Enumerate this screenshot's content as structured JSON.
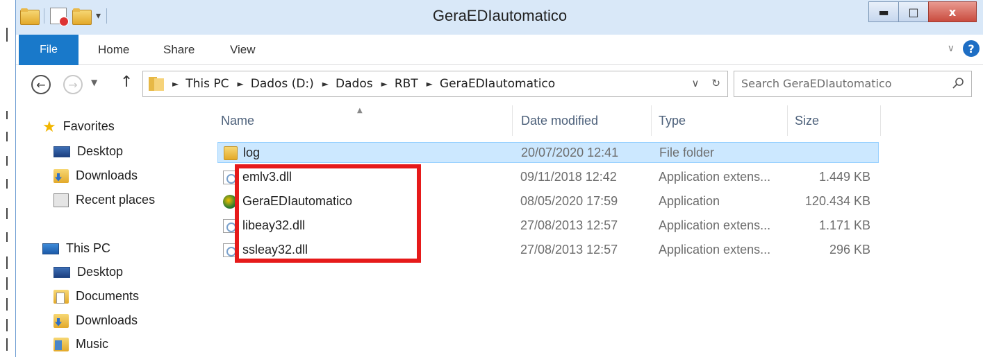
{
  "window": {
    "title": "GeraEDIautomatico",
    "minimize": "▬",
    "maximize": "□",
    "close": "x"
  },
  "ribbon": {
    "tabs": [
      "File",
      "Home",
      "Share",
      "View"
    ],
    "help": "?",
    "expand": "∨"
  },
  "nav": {
    "back": "←",
    "forward": "→",
    "recent": "▼",
    "up": "↑",
    "path": [
      "This PC",
      "Dados (D:)",
      "Dados",
      "RBT",
      "GeraEDIautomatico"
    ],
    "path_separator": "►",
    "dropdown": "∨",
    "refresh": "↻"
  },
  "search": {
    "placeholder": "Search GeraEDIautomatico"
  },
  "sidebar": {
    "favorites_label": "Favorites",
    "favorites": [
      "Desktop",
      "Downloads",
      "Recent places"
    ],
    "thispc_label": "This PC",
    "thispc": [
      "Desktop",
      "Documents",
      "Downloads",
      "Music"
    ]
  },
  "columns": {
    "name": "Name",
    "date": "Date modified",
    "type": "Type",
    "size": "Size"
  },
  "files": [
    {
      "name": "log",
      "date": "20/07/2020 12:41",
      "type": "File folder",
      "size": "",
      "icon": "folder-icon"
    },
    {
      "name": "emlv3.dll",
      "date": "09/11/2018 12:42",
      "type": "Application extens...",
      "size": "1.449 KB",
      "icon": "dll-icon"
    },
    {
      "name": "GeraEDIautomatico",
      "date": "08/05/2020 17:59",
      "type": "Application",
      "size": "120.434 KB",
      "icon": "app-icon"
    },
    {
      "name": "libeay32.dll",
      "date": "27/08/2013 12:57",
      "type": "Application extens...",
      "size": "1.171 KB",
      "icon": "dll-icon"
    },
    {
      "name": "ssleay32.dll",
      "date": "27/08/2013 12:57",
      "type": "Application extens...",
      "size": "296 KB",
      "icon": "dll-icon"
    }
  ],
  "colors": {
    "highlight": "#e61a1a",
    "accent": "#1979ca",
    "selection": "#cce8ff"
  }
}
